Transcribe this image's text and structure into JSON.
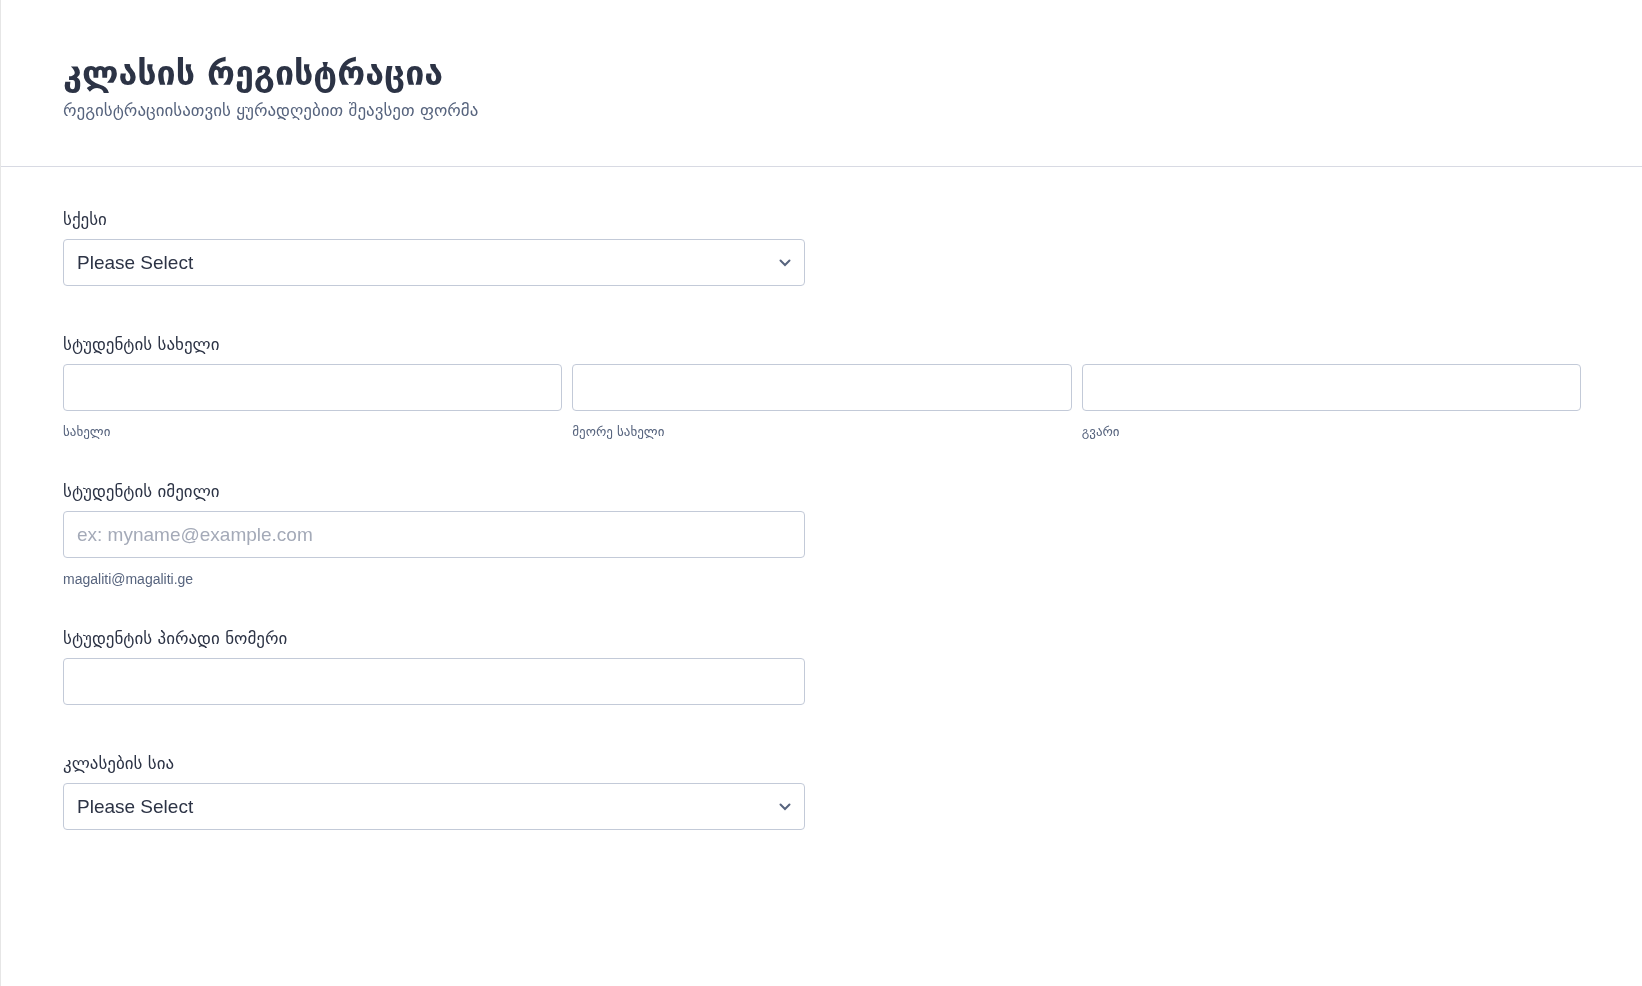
{
  "header": {
    "title": "კლასის რეგისტრაცია",
    "subtitle": "რეგისტრაციისათვის ყურადღებით შეავსეთ ფორმა"
  },
  "fields": [
    {
      "kind": "select",
      "label": "სქესი",
      "value": "Please Select"
    },
    {
      "kind": "name",
      "label": "სტუდენტის სახელი",
      "parts": [
        {
          "sublabel": "სახელი"
        },
        {
          "sublabel": "მეორე სახელი"
        },
        {
          "sublabel": "გვარი"
        }
      ]
    },
    {
      "kind": "email",
      "label": "სტუდენტის იმეილი",
      "placeholder": "ex: myname@example.com",
      "sublabel": "magaliti@magaliti.ge"
    },
    {
      "kind": "text",
      "label": "სტუდენტის პირადი ნომერი"
    },
    {
      "kind": "select",
      "label": "კლასების სია",
      "value": "Please Select"
    }
  ]
}
